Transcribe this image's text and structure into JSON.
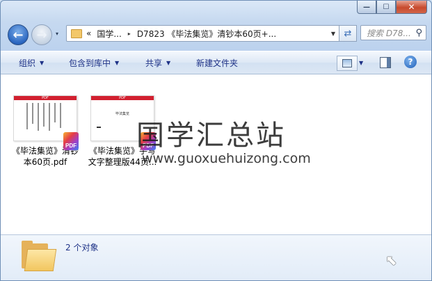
{
  "window": {
    "minimize": "—",
    "maximize": "☐",
    "close": "✕"
  },
  "nav": {
    "back_icon": "←",
    "forward_icon": "→",
    "history_icon": "▾"
  },
  "address": {
    "overflow": "«",
    "segments": [
      "国学...",
      "D7823 《毕法集览》清钞本60页+..."
    ],
    "separator": "▸",
    "dropdown": "▼"
  },
  "refresh_icon": "⇄",
  "search": {
    "placeholder": "搜索 D78...",
    "icon": "⚲"
  },
  "toolbar": {
    "organize": "组织",
    "include_library": "包含到库中",
    "share": "共享",
    "new_folder": "新建文件夹",
    "arrow": "▼",
    "help": "?"
  },
  "files": [
    {
      "name_line1": "《毕法集览》清钞",
      "name_line2": "本60页.pdf",
      "thumb_header": "PDF",
      "badge": "PDF"
    },
    {
      "name_line1": "《毕法集览》手写",
      "name_line2": "文字整理版44页...",
      "thumb_header": "PDF",
      "thumb_title": "毕法集览",
      "badge": "PDF"
    }
  ],
  "watermark": {
    "chinese": "国学汇总站",
    "url": "www.guoxuehuizong.com"
  },
  "details": {
    "count": "2 个对象"
  },
  "cursor_icon": "⬉"
}
